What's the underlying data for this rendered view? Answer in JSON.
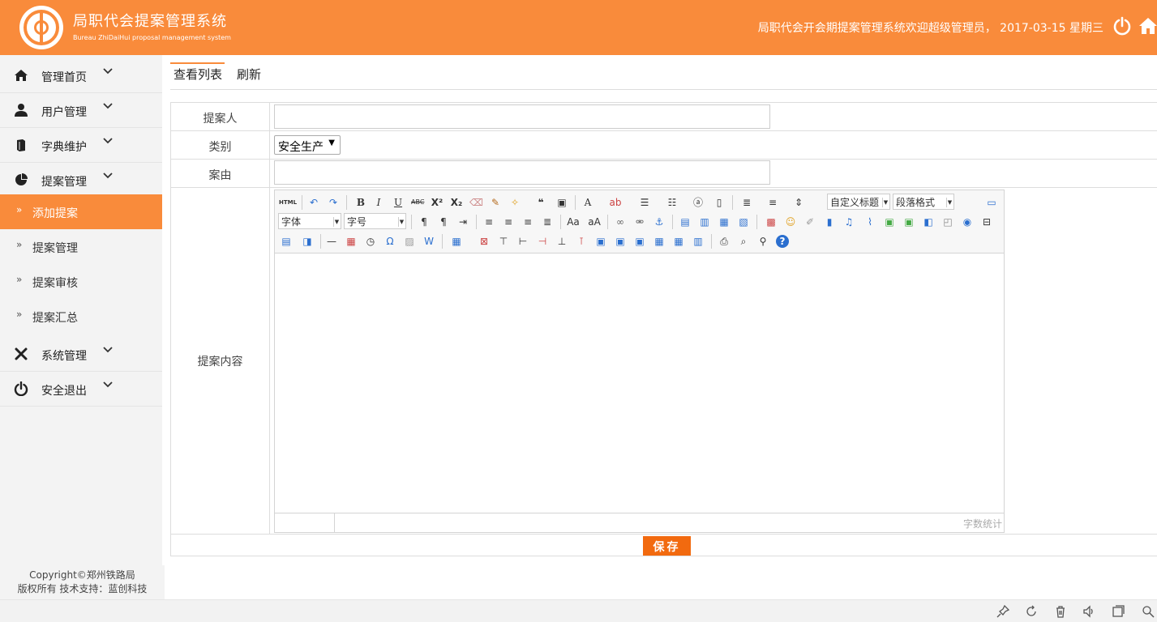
{
  "header": {
    "title": "局职代会提案管理系统",
    "subtitle": "Bureau ZhiDaiHui proposal management system",
    "welcome": "局职代会开会期提案管理系统欢迎超级管理员， 2017-03-15 星期三",
    "accent": "#f98b3b"
  },
  "sidebar": {
    "items": [
      {
        "label": "管理首页",
        "icon": "home-icon"
      },
      {
        "label": "用户管理",
        "icon": "user-icon"
      },
      {
        "label": "字典维护",
        "icon": "book-icon"
      },
      {
        "label": "提案管理",
        "icon": "pie-chart-icon"
      }
    ],
    "sub_items": [
      {
        "label": "添加提案",
        "active": true
      },
      {
        "label": "提案管理",
        "active": false
      },
      {
        "label": "提案审核",
        "active": false
      },
      {
        "label": "提案汇总",
        "active": false
      }
    ],
    "items2": [
      {
        "label": "系统管理",
        "icon": "wrench-icon"
      },
      {
        "label": "安全退出",
        "icon": "power-icon"
      }
    ],
    "footer_line1": "Copyright©郑州铁路局",
    "footer_line2": "版权所有 技术支持：蓝创科技"
  },
  "tabs": [
    {
      "label": "查看列表",
      "active": true
    },
    {
      "label": "刷新",
      "active": false
    }
  ],
  "form": {
    "proposer_label": "提案人",
    "proposer_value": "",
    "category_label": "类别",
    "category_value": "安全生产",
    "reason_label": "案由",
    "reason_value": "",
    "content_label": "提案内容",
    "save_label": "保存"
  },
  "editor": {
    "custom_heading": "自定义标题",
    "paragraph_format": "段落格式",
    "font_family": "字体",
    "font_size": "字号",
    "html_label": "HTML",
    "word_count": "字数统计"
  }
}
